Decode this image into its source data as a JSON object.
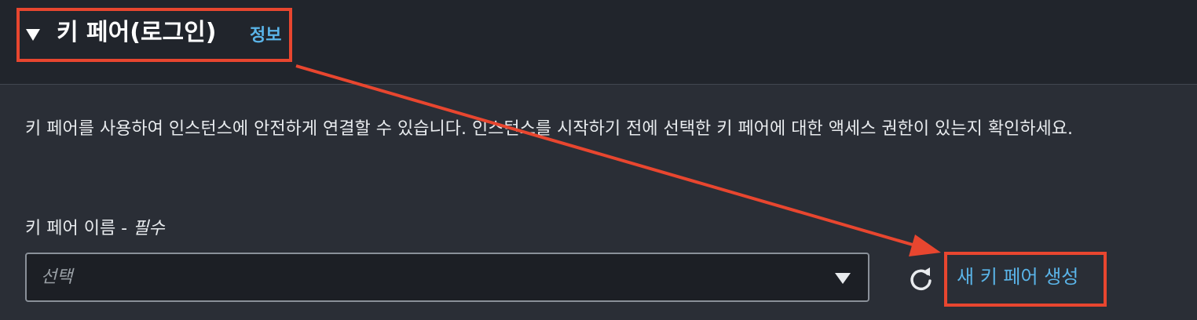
{
  "section": {
    "title": "키 페어(로그인)",
    "info_link": "정보",
    "description": "키 페어를 사용하여 인스턴스에 안전하게 연결할 수 있습니다. 인스턴스를 시작하기 전에 선택한 키 페어에 대한 액세스 권한이 있는지 확인하세요."
  },
  "key_pair_field": {
    "label": "키 페어 이름 - ",
    "required": "필수",
    "placeholder": "선택"
  },
  "actions": {
    "create_label": "새 키 페어 생성"
  },
  "colors": {
    "background": "#2a2e36",
    "header_background": "#21252c",
    "link": "#5ab4e8",
    "annotation": "#e8462f"
  },
  "icons": {
    "collapse": "caret-down-icon",
    "refresh": "refresh-icon",
    "dropdown": "dropdown-caret-icon"
  }
}
